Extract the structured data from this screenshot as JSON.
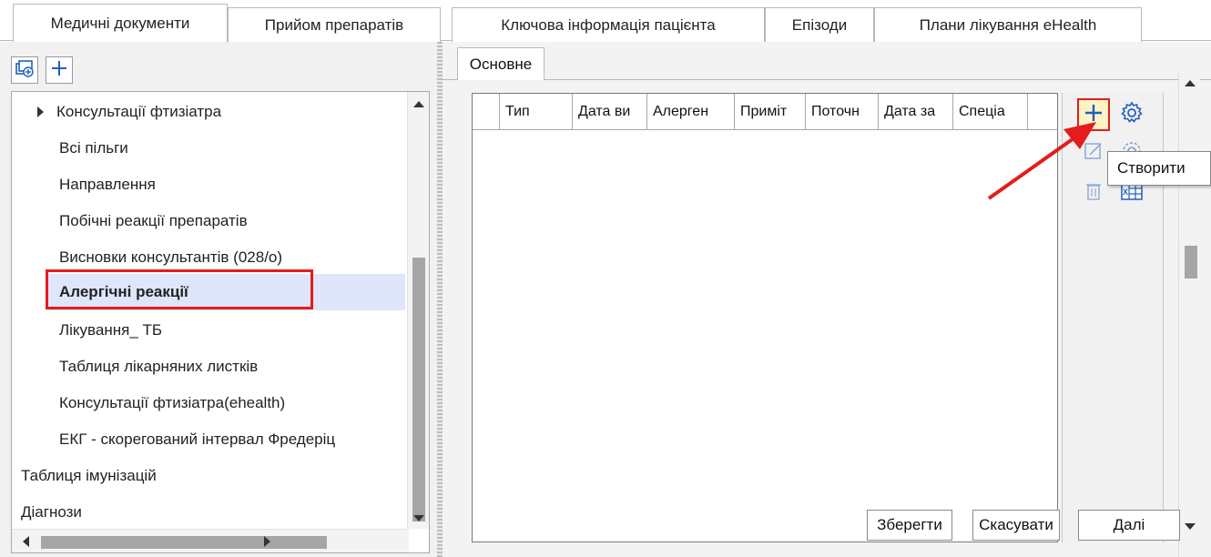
{
  "top_tabs": [
    "Медичні документи",
    "Прийом препаратів",
    "Ключова інформація пацієнта",
    "Епізоди",
    "Плани лікування eHealth"
  ],
  "left_tree": {
    "items": [
      {
        "label": "Консультації фтизіатра",
        "expandable": true
      },
      {
        "label": "Всі пільги"
      },
      {
        "label": "Направлення"
      },
      {
        "label": "Побічні реакції препаратів"
      },
      {
        "label": "Висновки консультантів (028/о)"
      },
      {
        "label": "Алергічні реакції",
        "selected": true
      },
      {
        "label": "Лікування_ ТБ"
      },
      {
        "label": "Таблиця лікарняних листків"
      },
      {
        "label": "Консультації фтизіатра(ehealth)"
      },
      {
        "label": "ЕКГ - скорегований інтервал Фредеріц"
      },
      {
        "label": "Таблиця імунізацій"
      },
      {
        "label": "Діагнози"
      }
    ]
  },
  "sub_tab": "Основне",
  "grid": {
    "columns": [
      "Тип",
      "Дата ви",
      "Алерген",
      "Приміт",
      "Поточн",
      "Дата за",
      "Спеціа"
    ]
  },
  "tooltip": "Створити",
  "buttons": {
    "save": "Зберегти",
    "cancel": "Скасувати",
    "next": "Далі"
  },
  "colors": {
    "highlight_red": "#e41c1c",
    "selection_blue": "#dfe5fb",
    "plus_blue": "#1f5fbf"
  }
}
